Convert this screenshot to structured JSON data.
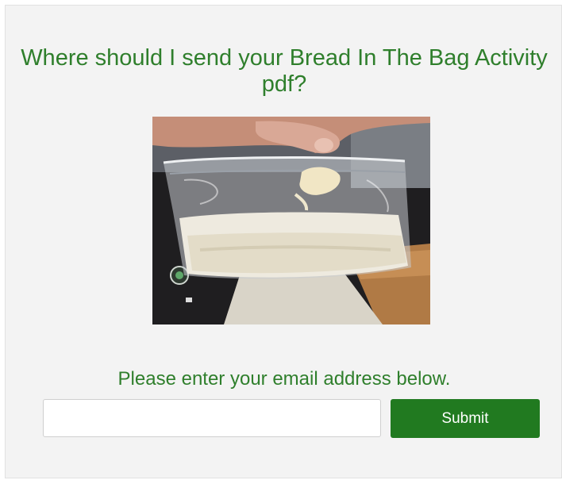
{
  "form": {
    "heading": "Where should I send your Bread In The Bag Activity pdf?",
    "prompt": "Please enter your email address below.",
    "email_value": "",
    "email_placeholder": "",
    "submit_label": "Submit"
  },
  "colors": {
    "heading_green": "#2f7f2c",
    "button_green": "#217a20",
    "panel_background": "#f3f3f3"
  },
  "image": {
    "description_icon": "photo-bread-in-bag"
  }
}
